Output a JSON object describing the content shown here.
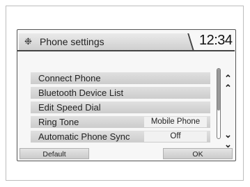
{
  "header": {
    "title": "Phone settings",
    "clock": "12:34",
    "icon": "gear-icon"
  },
  "menu": {
    "items": [
      {
        "label": "Connect Phone",
        "value": ""
      },
      {
        "label": "Bluetooth Device List",
        "value": ""
      },
      {
        "label": "Edit Speed Dial",
        "value": ""
      },
      {
        "label": "Ring Tone",
        "value": "Mobile Phone"
      },
      {
        "label": "Automatic Phone Sync",
        "value": "Off"
      }
    ]
  },
  "scroll": {
    "up_icon": "chevron-double-up-icon",
    "down_icon": "chevron-double-down-icon"
  },
  "footer": {
    "default_label": "Default",
    "ok_label": "OK"
  }
}
